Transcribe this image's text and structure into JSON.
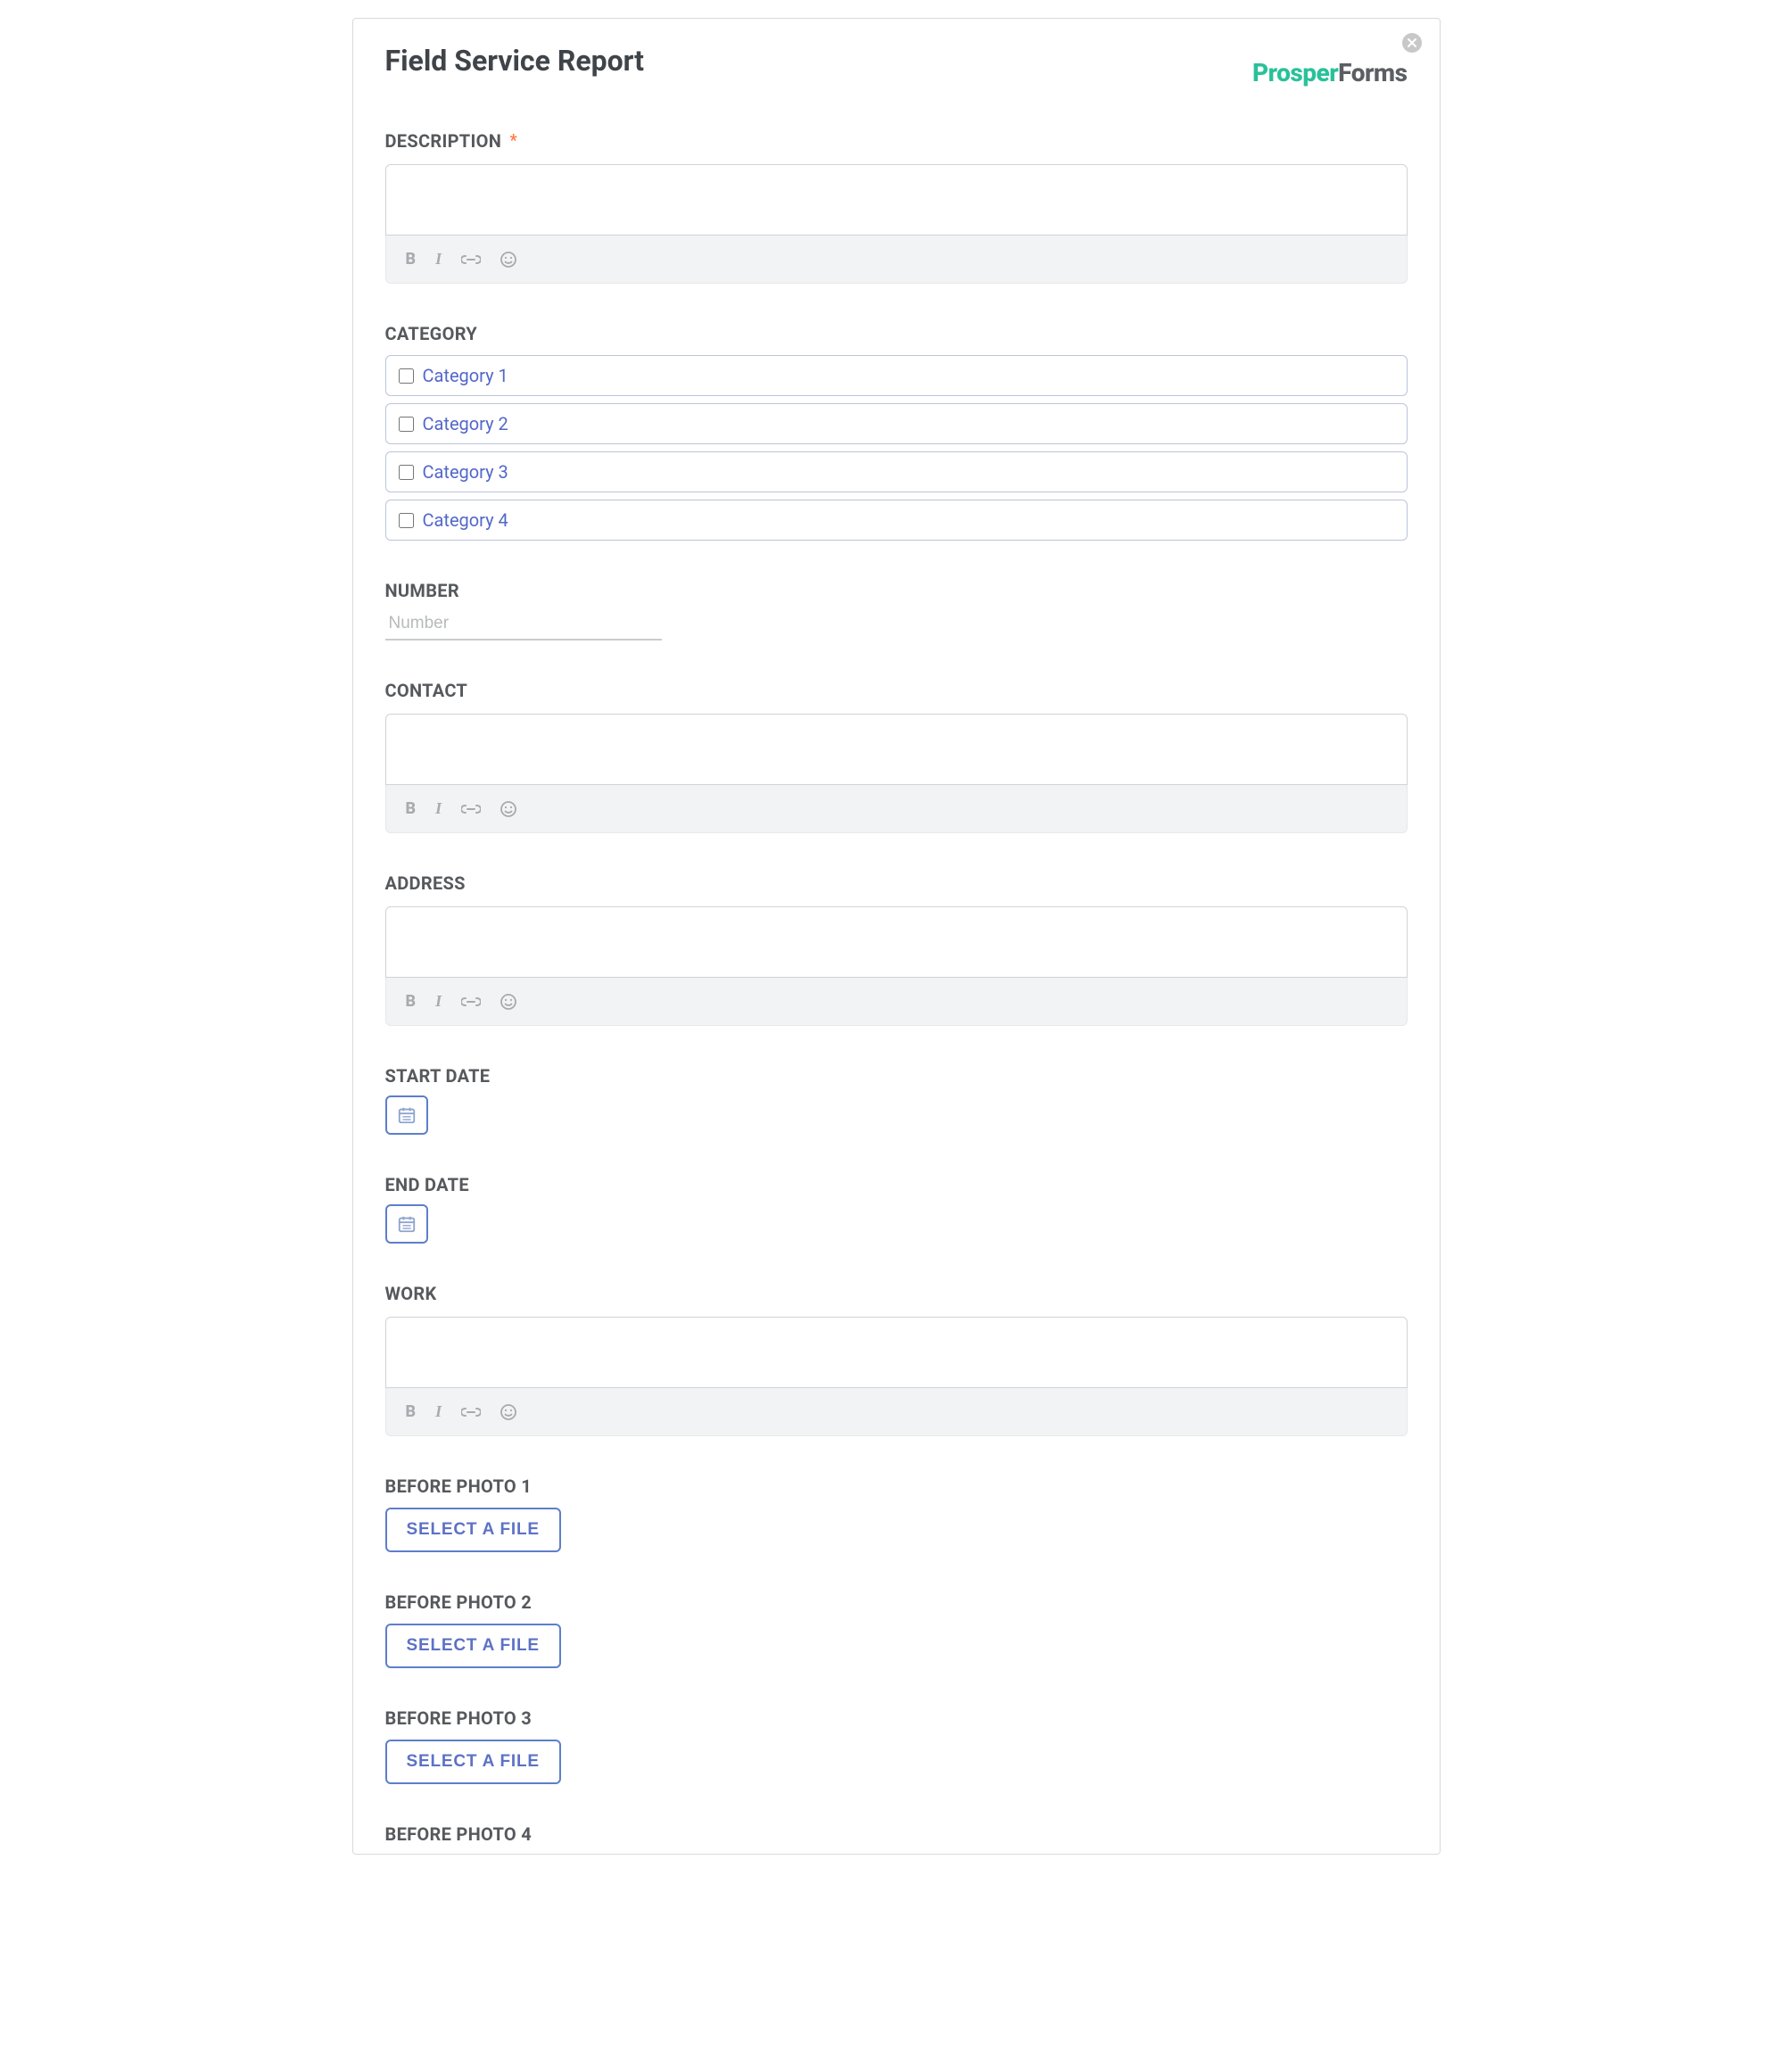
{
  "logo": {
    "part1": "Prosper",
    "part2": "Forms"
  },
  "title": "Field Service Report",
  "labels": {
    "description": "DESCRIPTION",
    "category": "CATEGORY",
    "number": "NUMBER",
    "contact": "CONTACT",
    "address": "ADDRESS",
    "start_date": "START DATE",
    "end_date": "END DATE",
    "work": "WORK",
    "before_photo_1": "BEFORE PHOTO 1",
    "before_photo_2": "BEFORE PHOTO 2",
    "before_photo_3": "BEFORE PHOTO 3",
    "before_photo_4": "BEFORE PHOTO 4"
  },
  "required_mark": "*",
  "categories": [
    {
      "label": "Category 1"
    },
    {
      "label": "Category 2"
    },
    {
      "label": "Category 3"
    },
    {
      "label": "Category 4"
    }
  ],
  "number_placeholder": "Number",
  "select_file_label": "SELECT A FILE",
  "toolbar": {
    "bold": "B",
    "italic": "I"
  }
}
